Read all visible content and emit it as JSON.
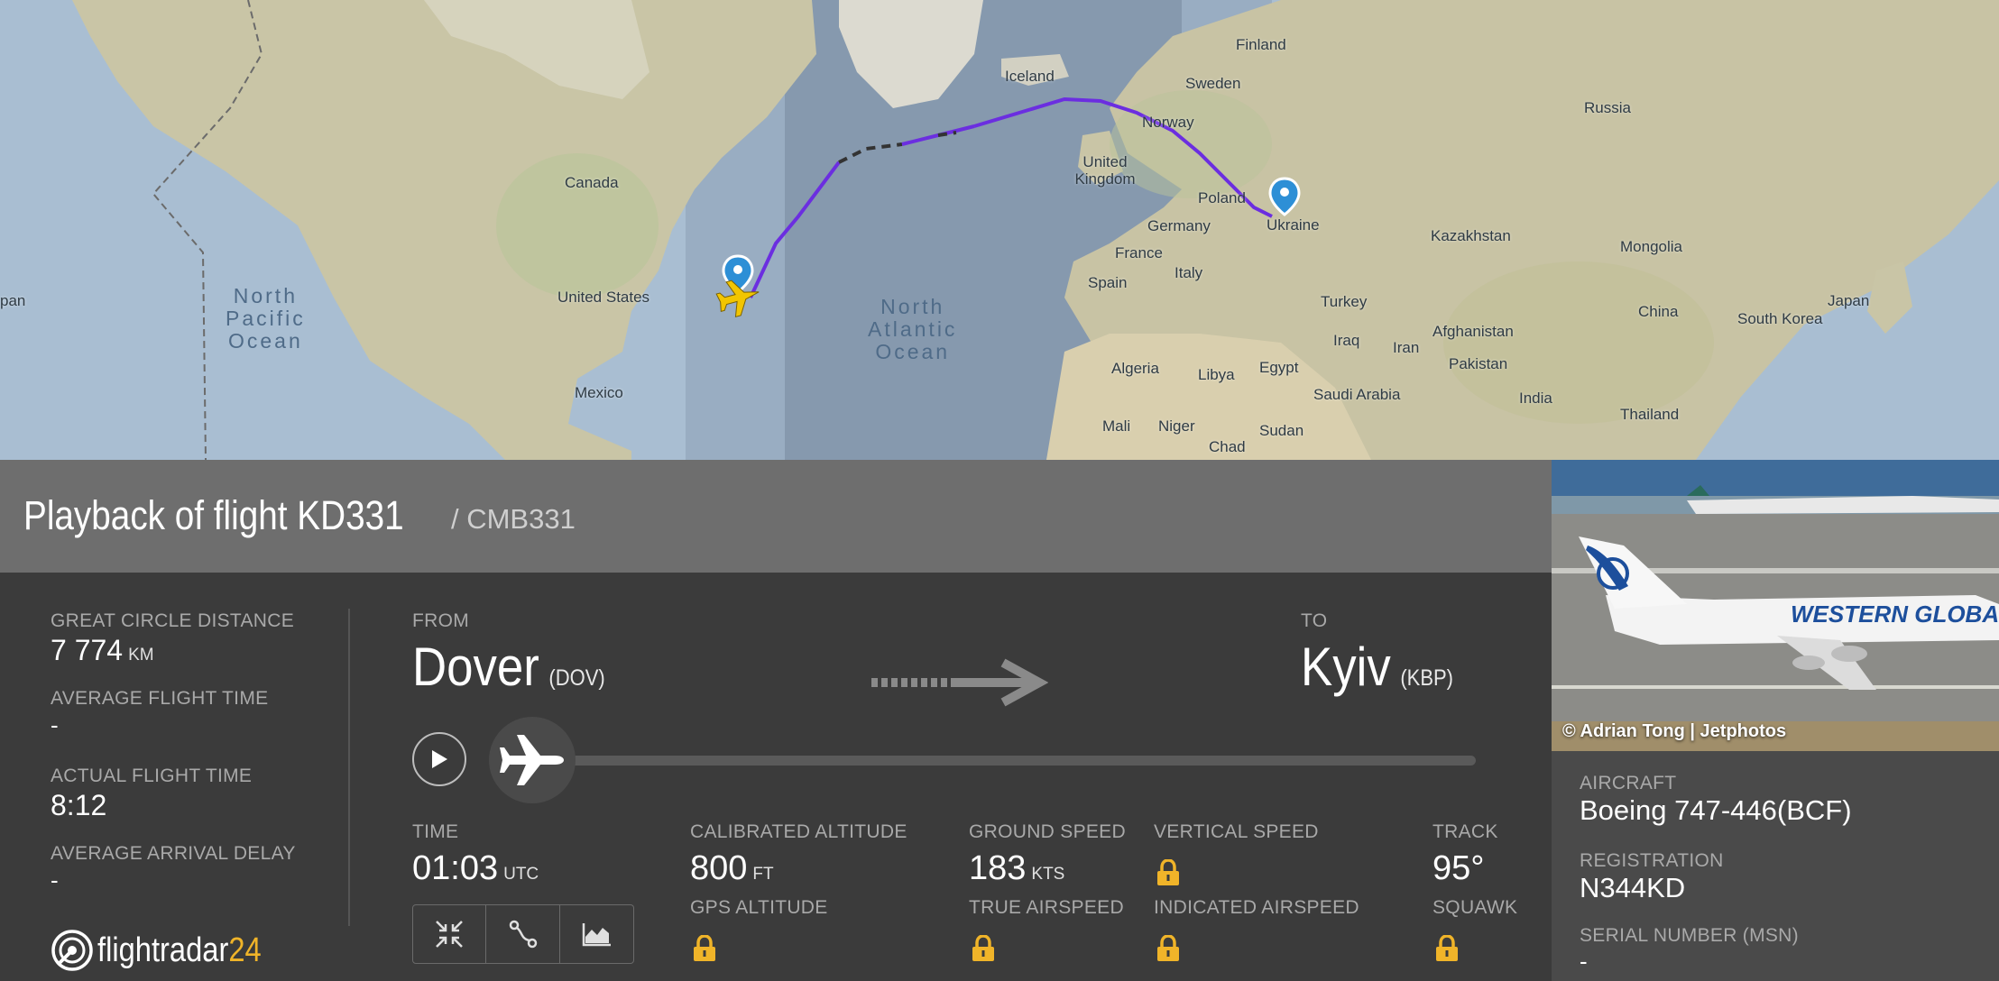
{
  "map": {
    "countries": [
      "Canada",
      "United States",
      "Mexico",
      "Iceland",
      "Finland",
      "Sweden",
      "Norway",
      "United Kingdom",
      "Poland",
      "Germany",
      "France",
      "Ukraine",
      "Spain",
      "Italy",
      "Turkey",
      "Iraq",
      "Iran",
      "Algeria",
      "Libya",
      "Egypt",
      "Saudi Arabia",
      "Mali",
      "Niger",
      "Chad",
      "Sudan",
      "Russia",
      "Kazakhstan",
      "Afghanistan",
      "Pakistan",
      "India",
      "Mongolia",
      "China",
      "South Korea",
      "Japan",
      "Thailand",
      "pan"
    ],
    "oceans": [
      "North\nPacific\nOcean",
      "North\nAtlantic\nOcean"
    ],
    "route_color": "#6b2ee0"
  },
  "header": {
    "title": "Playback of flight KD331",
    "callsign": "/ CMB331"
  },
  "stats": {
    "gcd_label": "GREAT CIRCLE DISTANCE",
    "gcd_value": "7 774",
    "gcd_unit": "KM",
    "aft_label": "AVERAGE FLIGHT TIME",
    "aft_value": "-",
    "act_label": "ACTUAL FLIGHT TIME",
    "act_value": "8:12",
    "aad_label": "AVERAGE ARRIVAL DELAY",
    "aad_value": "-"
  },
  "logo": {
    "text_main": "flightradar",
    "text_num": "24"
  },
  "route": {
    "from_label": "FROM",
    "from_city": "Dover",
    "from_code": "(DOV)",
    "to_label": "TO",
    "to_city": "Kyiv",
    "to_code": "(KBP)"
  },
  "playback": {
    "progress": 0.0
  },
  "telemetry": {
    "time_label": "TIME",
    "time_value": "01:03",
    "time_unit": "UTC",
    "calalt_label": "CALIBRATED ALTITUDE",
    "calalt_value": "800",
    "calalt_unit": "FT",
    "gpsalt_label": "GPS ALTITUDE",
    "gs_label": "GROUND SPEED",
    "gs_value": "183",
    "gs_unit": "KTS",
    "tas_label": "TRUE AIRSPEED",
    "vs_label": "VERTICAL SPEED",
    "ias_label": "INDICATED AIRSPEED",
    "track_label": "TRACK",
    "track_value": "95°",
    "squawk_label": "SQUAWK"
  },
  "aircraft": {
    "photo_credit": "© Adrian Tong | Jetphotos",
    "photo_livery_text": "WESTERN GLOBAL",
    "aircraft_label": "AIRCRAFT",
    "aircraft_value": "Boeing 747-446(BCF)",
    "reg_label": "REGISTRATION",
    "reg_value": "N344KD",
    "msn_label": "SERIAL NUMBER (MSN)",
    "msn_value": "-"
  },
  "colors": {
    "lock": "#f0b429",
    "logo_accent": "#f0b429",
    "plane_marker": "#f2c500"
  }
}
